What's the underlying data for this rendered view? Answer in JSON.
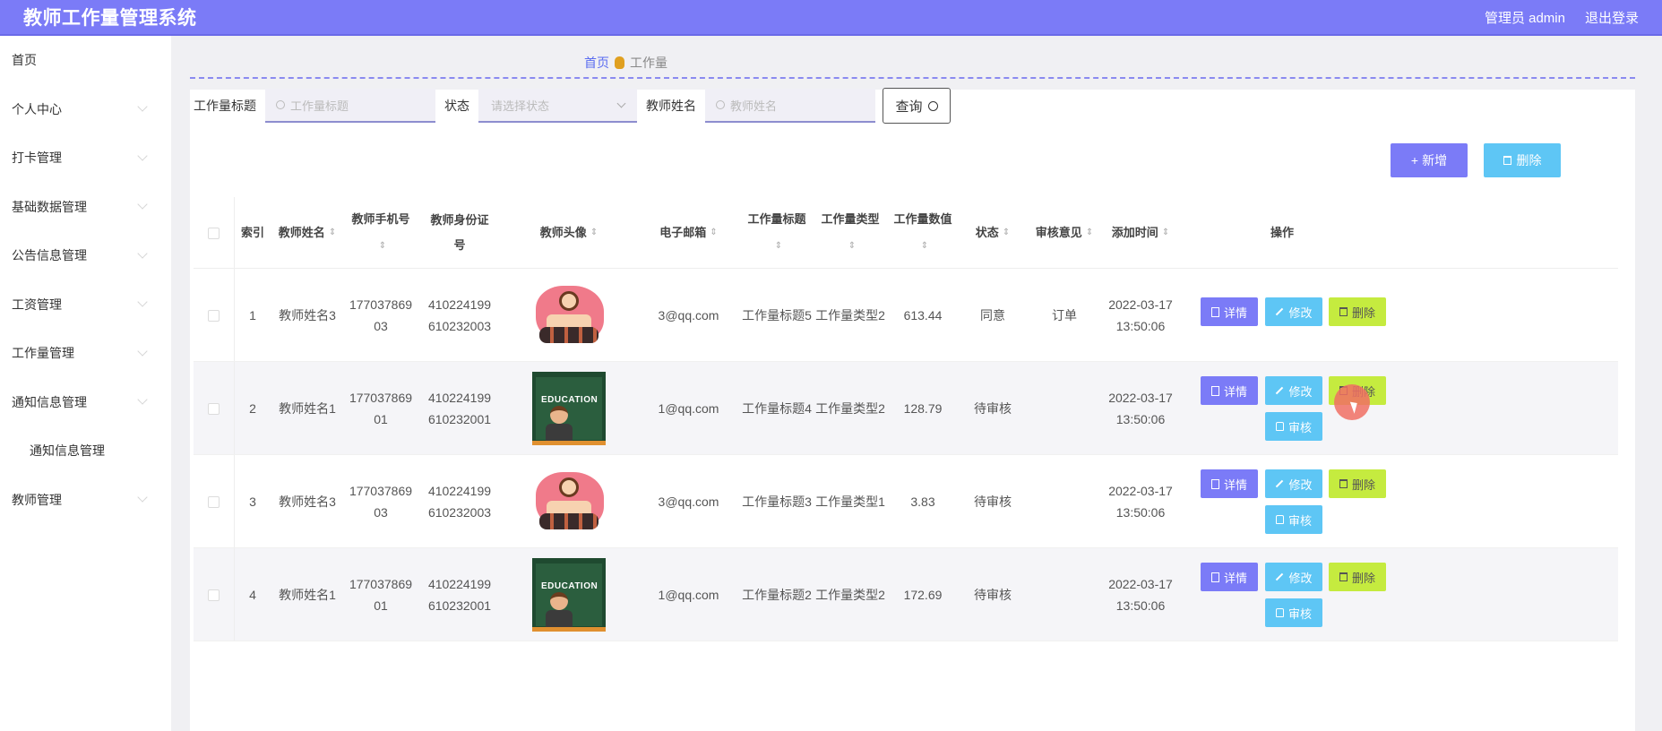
{
  "header": {
    "title": "教师工作量管理系统",
    "user_label": "管理员 admin",
    "logout_label": "退出登录"
  },
  "sidebar": {
    "items": [
      {
        "label": "首页",
        "has_chevron": false
      },
      {
        "label": "个人中心",
        "has_chevron": true
      },
      {
        "label": "打卡管理",
        "has_chevron": true
      },
      {
        "label": "基础数据管理",
        "has_chevron": true
      },
      {
        "label": "公告信息管理",
        "has_chevron": true
      },
      {
        "label": "工资管理",
        "has_chevron": true
      },
      {
        "label": "工作量管理",
        "has_chevron": true
      },
      {
        "label": "通知信息管理",
        "has_chevron": true
      },
      {
        "label": "通知信息管理",
        "has_chevron": false,
        "sub": true
      },
      {
        "label": "教师管理",
        "has_chevron": true
      }
    ]
  },
  "breadcrumb": {
    "home": "首页",
    "current": "工作量"
  },
  "search": {
    "title_label": "工作量标题",
    "title_placeholder": "工作量标题",
    "status_label": "状态",
    "status_placeholder": "请选择状态",
    "name_label": "教师姓名",
    "name_placeholder": "教师姓名",
    "query_label": "查询"
  },
  "toolbar": {
    "add_label": "新增",
    "delete_label": "删除"
  },
  "table": {
    "headers": {
      "index": "索引",
      "name": "教师姓名",
      "phone": "教师手机号",
      "idcard": "教师身份证号",
      "avatar": "教师头像",
      "email": "电子邮箱",
      "title": "工作量标题",
      "type": "工作量类型",
      "value": "工作量数值",
      "status": "状态",
      "opinion": "审核意见",
      "time": "添加时间",
      "ops": "操作"
    },
    "buttons": {
      "detail": "详情",
      "edit": "修改",
      "delete": "删除",
      "audit": "审核"
    },
    "rows": [
      {
        "index": "1",
        "name": "教师姓名3",
        "phone1": "177037869",
        "phone2": "03",
        "id1": "410224199",
        "id2": "610232003",
        "avatar": "girl",
        "email": "3@qq.com",
        "title": "工作量标题5",
        "type": "工作量类型2",
        "value": "613.44",
        "status": "同意",
        "opinion": "订单",
        "date": "2022-03-17",
        "time": "13:50:06",
        "audit": false
      },
      {
        "index": "2",
        "name": "教师姓名1",
        "phone1": "177037869",
        "phone2": "01",
        "id1": "410224199",
        "id2": "610232001",
        "avatar": "education",
        "email": "1@qq.com",
        "title": "工作量标题4",
        "type": "工作量类型2",
        "value": "128.79",
        "status": "待审核",
        "opinion": "",
        "date": "2022-03-17",
        "time": "13:50:06",
        "audit": true
      },
      {
        "index": "3",
        "name": "教师姓名3",
        "phone1": "177037869",
        "phone2": "03",
        "id1": "410224199",
        "id2": "610232003",
        "avatar": "girl",
        "email": "3@qq.com",
        "title": "工作量标题3",
        "type": "工作量类型1",
        "value": "3.83",
        "status": "待审核",
        "opinion": "",
        "date": "2022-03-17",
        "time": "13:50:06",
        "audit": true
      },
      {
        "index": "4",
        "name": "教师姓名1",
        "phone1": "177037869",
        "phone2": "01",
        "id1": "410224199",
        "id2": "610232001",
        "avatar": "education",
        "email": "1@qq.com",
        "title": "工作量标题2",
        "type": "工作量类型2",
        "value": "172.69",
        "status": "待审核",
        "opinion": "",
        "date": "2022-03-17",
        "time": "13:50:06",
        "audit": true
      }
    ]
  },
  "avatar_text": "EDUCATION"
}
